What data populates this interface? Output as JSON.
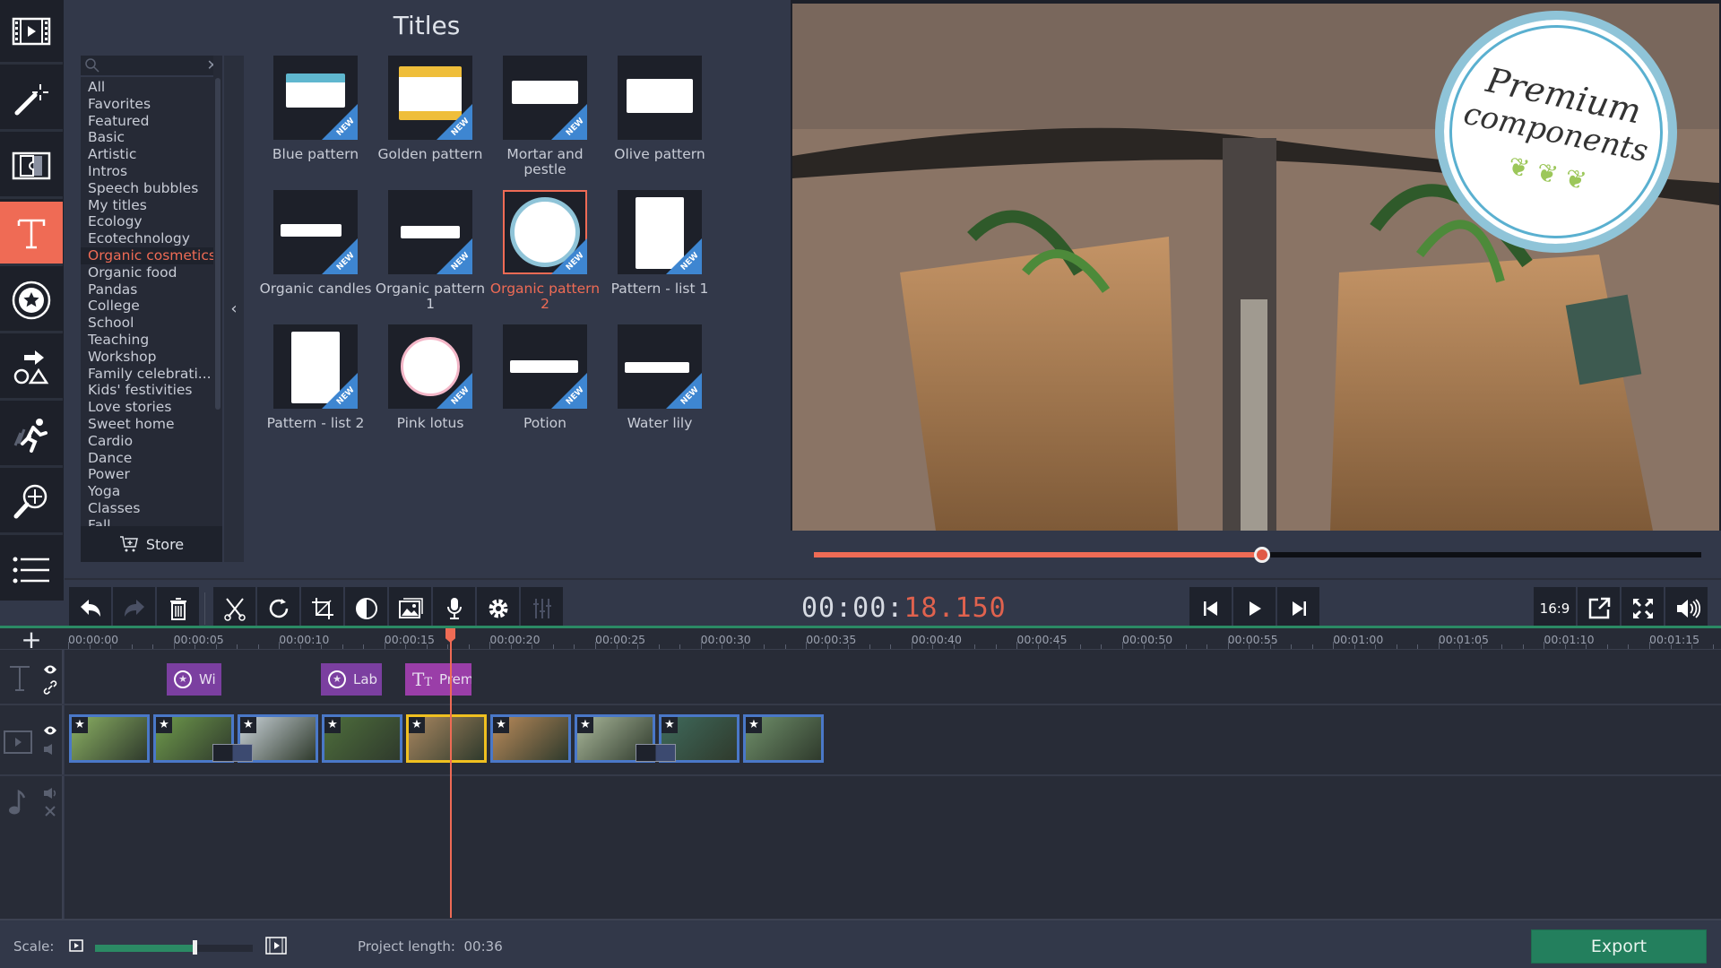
{
  "rail": {
    "items": [
      {
        "name": "import",
        "icon": "film-play-icon",
        "active": false
      },
      {
        "name": "filters",
        "icon": "magic-wand-icon",
        "active": false
      },
      {
        "name": "transitions",
        "icon": "film-transition-icon",
        "active": false
      },
      {
        "name": "titles",
        "icon": "text-t-icon",
        "active": true
      },
      {
        "name": "stickers",
        "icon": "star-sticker-icon",
        "active": false
      },
      {
        "name": "callouts",
        "icon": "shapes-arrow-icon",
        "active": false
      },
      {
        "name": "animation",
        "icon": "running-man-icon",
        "active": false
      },
      {
        "name": "zoom-pan",
        "icon": "magnifier-move-icon",
        "active": false
      },
      {
        "name": "more",
        "icon": "list-icon",
        "active": false
      }
    ]
  },
  "panel": {
    "title": "Titles",
    "search": {
      "placeholder": "",
      "value": ""
    },
    "categories": [
      "All",
      "Favorites",
      "Featured",
      "Basic",
      "Artistic",
      "Intros",
      "Speech bubbles",
      "My titles",
      "Ecology",
      "Ecotechnology",
      "Organic cosmetics",
      "Organic food",
      "Pandas",
      "College",
      "School",
      "Teaching",
      "Workshop",
      "Family celebrati...",
      "Kids' festivities",
      "Love stories",
      "Sweet home",
      "Cardio",
      "Dance",
      "Power",
      "Yoga",
      "Classes",
      "Fall"
    ],
    "selected_category": "Organic cosmetics",
    "store_label": "Store",
    "new_badge": "NEW",
    "tiles": [
      {
        "label": "Blue pattern",
        "new": true,
        "selected": false
      },
      {
        "label": "Golden pattern",
        "new": true,
        "selected": false
      },
      {
        "label": "Mortar and pestle",
        "new": true,
        "selected": false
      },
      {
        "label": "Olive pattern",
        "new": false,
        "selected": false
      },
      {
        "label": "Organic candles",
        "new": true,
        "selected": false
      },
      {
        "label": "Organic pattern 1",
        "new": true,
        "selected": false
      },
      {
        "label": "Organic pattern 2",
        "new": true,
        "selected": true
      },
      {
        "label": "Pattern - list 1",
        "new": true,
        "selected": false
      },
      {
        "label": "Pattern - list 2",
        "new": true,
        "selected": false
      },
      {
        "label": "Pink lotus",
        "new": true,
        "selected": false
      },
      {
        "label": "Potion",
        "new": true,
        "selected": false
      },
      {
        "label": "Water lily",
        "new": true,
        "selected": false
      }
    ]
  },
  "preview": {
    "overlay_title_line1": "Premium",
    "overlay_title_line2": "components",
    "progress_fraction": 0.505
  },
  "toolbar": {
    "buttons": [
      "undo",
      "redo",
      "delete",
      "cut",
      "rotate",
      "crop",
      "color-adjust",
      "image-overlay",
      "record-voice",
      "settings",
      "equalizer"
    ],
    "timecode_prefix": "00:00:",
    "timecode_value": "18.150",
    "aspect_ratio": "16:9"
  },
  "timeline": {
    "ruler": [
      "00:00:00",
      "00:00:05",
      "00:00:10",
      "00:00:15",
      "00:00:20",
      "00:00:25",
      "00:00:30",
      "00:00:35",
      "00:00:40",
      "00:00:45",
      "00:00:50",
      "00:00:55",
      "00:01:00",
      "00:01:05",
      "00:01:10",
      "00:01:15"
    ],
    "title_clips": [
      {
        "label": "Wi",
        "type": "sticker"
      },
      {
        "label": "Lab",
        "type": "sticker"
      },
      {
        "label": "Prem",
        "type": "text"
      }
    ],
    "video_clips": [
      {
        "name": "seedlings",
        "color": "#8bb063"
      },
      {
        "name": "fields",
        "color": "#6f9a4c"
      },
      {
        "name": "tree",
        "color": "#c9d2d8"
      },
      {
        "name": "leaf-hand",
        "color": "#4e6e3c"
      },
      {
        "name": "bags",
        "color": "#a88660",
        "selected": true
      },
      {
        "name": "salad",
        "color": "#b98a5a"
      },
      {
        "name": "plant-blur",
        "color": "#a9b79a"
      },
      {
        "name": "leaf-shirt",
        "color": "#3f6a5c"
      },
      {
        "name": "pot-plant",
        "color": "#6f8f6a"
      }
    ]
  },
  "status": {
    "scale_label": "Scale:",
    "scale_fraction": 0.63,
    "project_length_label": "Project length:",
    "project_length_value": "00:36",
    "export_label": "Export"
  },
  "colors": {
    "accent": "#ef6b55",
    "export": "#237f5d",
    "clip_border": "#4a78c8",
    "title_clip": "#7b3fa0"
  }
}
